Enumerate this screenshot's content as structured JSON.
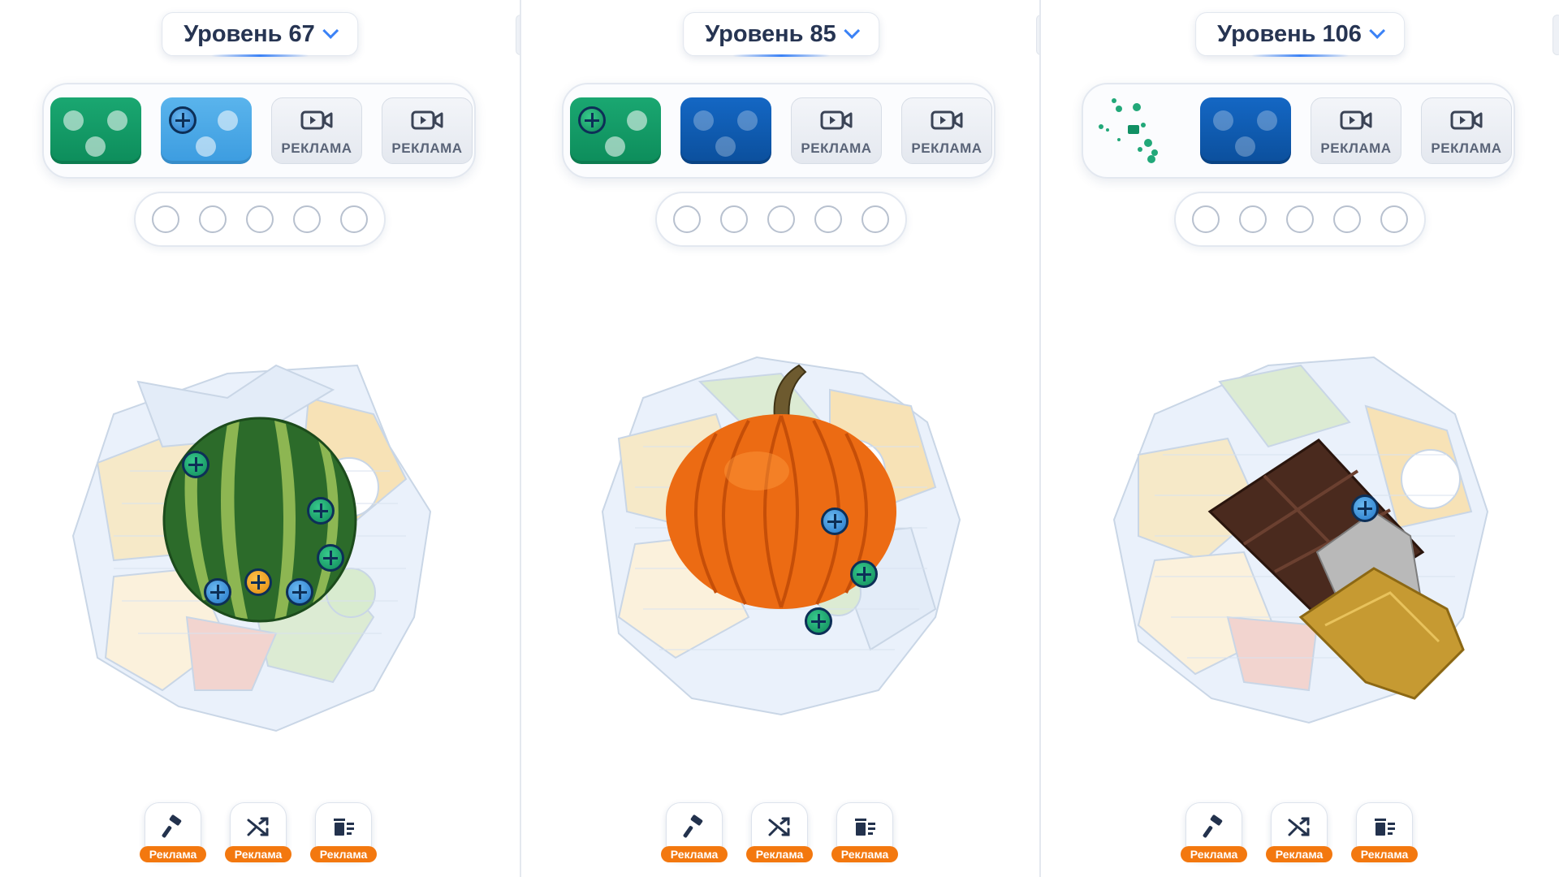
{
  "panels": [
    {
      "level_label": "Уровень 67",
      "object": "watermelon",
      "slots": [
        {
          "type": "green"
        },
        {
          "type": "lightblue",
          "screw": "blue"
        },
        {
          "type": "ad",
          "label": "РЕКЛАМА",
          "icon": "video-camera-icon"
        },
        {
          "type": "ad",
          "label": "РЕКЛАМА",
          "icon": "video-camera-icon"
        }
      ],
      "tools": [
        {
          "icon": "hammer-icon",
          "badge": "Реклама"
        },
        {
          "icon": "shuffle-icon",
          "badge": "Реклама"
        },
        {
          "icon": "trash-icon",
          "badge": "Реклама"
        }
      ]
    },
    {
      "level_label": "Уровень 85",
      "object": "pumpkin",
      "slots": [
        {
          "type": "green",
          "screw": "green"
        },
        {
          "type": "blue"
        },
        {
          "type": "ad",
          "label": "РЕКЛАМА",
          "icon": "video-camera-icon"
        },
        {
          "type": "ad",
          "label": "РЕКЛАМА",
          "icon": "video-camera-icon"
        }
      ],
      "tools": [
        {
          "icon": "hammer-icon",
          "badge": "Реклама"
        },
        {
          "icon": "shuffle-icon",
          "badge": "Реклама"
        },
        {
          "icon": "trash-icon",
          "badge": "Реклама"
        }
      ]
    },
    {
      "level_label": "Уровень 106",
      "object": "chocolate-bar",
      "slots": [
        {
          "type": "empty-burst"
        },
        {
          "type": "blue"
        },
        {
          "type": "ad",
          "label": "РЕКЛАМА",
          "icon": "video-camera-icon"
        },
        {
          "type": "ad",
          "label": "РЕКЛАМА",
          "icon": "video-camera-icon"
        }
      ],
      "tools": [
        {
          "icon": "hammer-icon",
          "badge": "Реклама"
        },
        {
          "icon": "shuffle-icon",
          "badge": "Реклама"
        },
        {
          "icon": "trash-icon",
          "badge": "Реклама"
        }
      ]
    }
  ],
  "empty_circles_per_panel": 5,
  "colors": {
    "green_slot": "#10955f",
    "lightblue_slot": "#4aa8e8",
    "blue_slot": "#0f5bb1",
    "ad_badge": "#f3780f",
    "level_text": "#263452",
    "accent": "#3b82f6"
  }
}
